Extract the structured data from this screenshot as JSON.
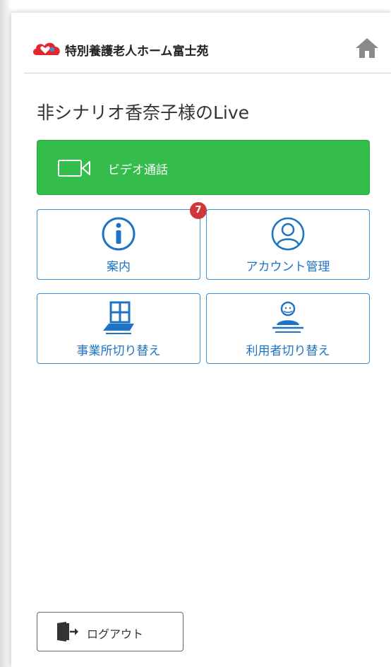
{
  "header": {
    "facility_name": "特別養護老人ホーム富士苑",
    "logo_icon": "cloud-heart-icon",
    "home_icon": "home-icon"
  },
  "page": {
    "title": "非シナリオ香奈子様のLive"
  },
  "video_call": {
    "label": "ビデオ通話",
    "icon": "video-camera-icon",
    "color": "#35bd4b"
  },
  "tiles": {
    "guide": {
      "label": "案内",
      "icon": "info-icon",
      "badge": "7"
    },
    "account": {
      "label": "アカウント管理",
      "icon": "user-circle-icon"
    },
    "office_switch": {
      "label": "事業所切り替え",
      "icon": "building-icon"
    },
    "user_switch": {
      "label": "利用者切り替え",
      "icon": "person-switch-icon"
    }
  },
  "logout": {
    "label": "ログアウト",
    "icon": "logout-door-icon"
  },
  "colors": {
    "accent_blue": "#1f73c4",
    "badge_red": "#d0363b",
    "home_gray": "#8a8a8a"
  }
}
